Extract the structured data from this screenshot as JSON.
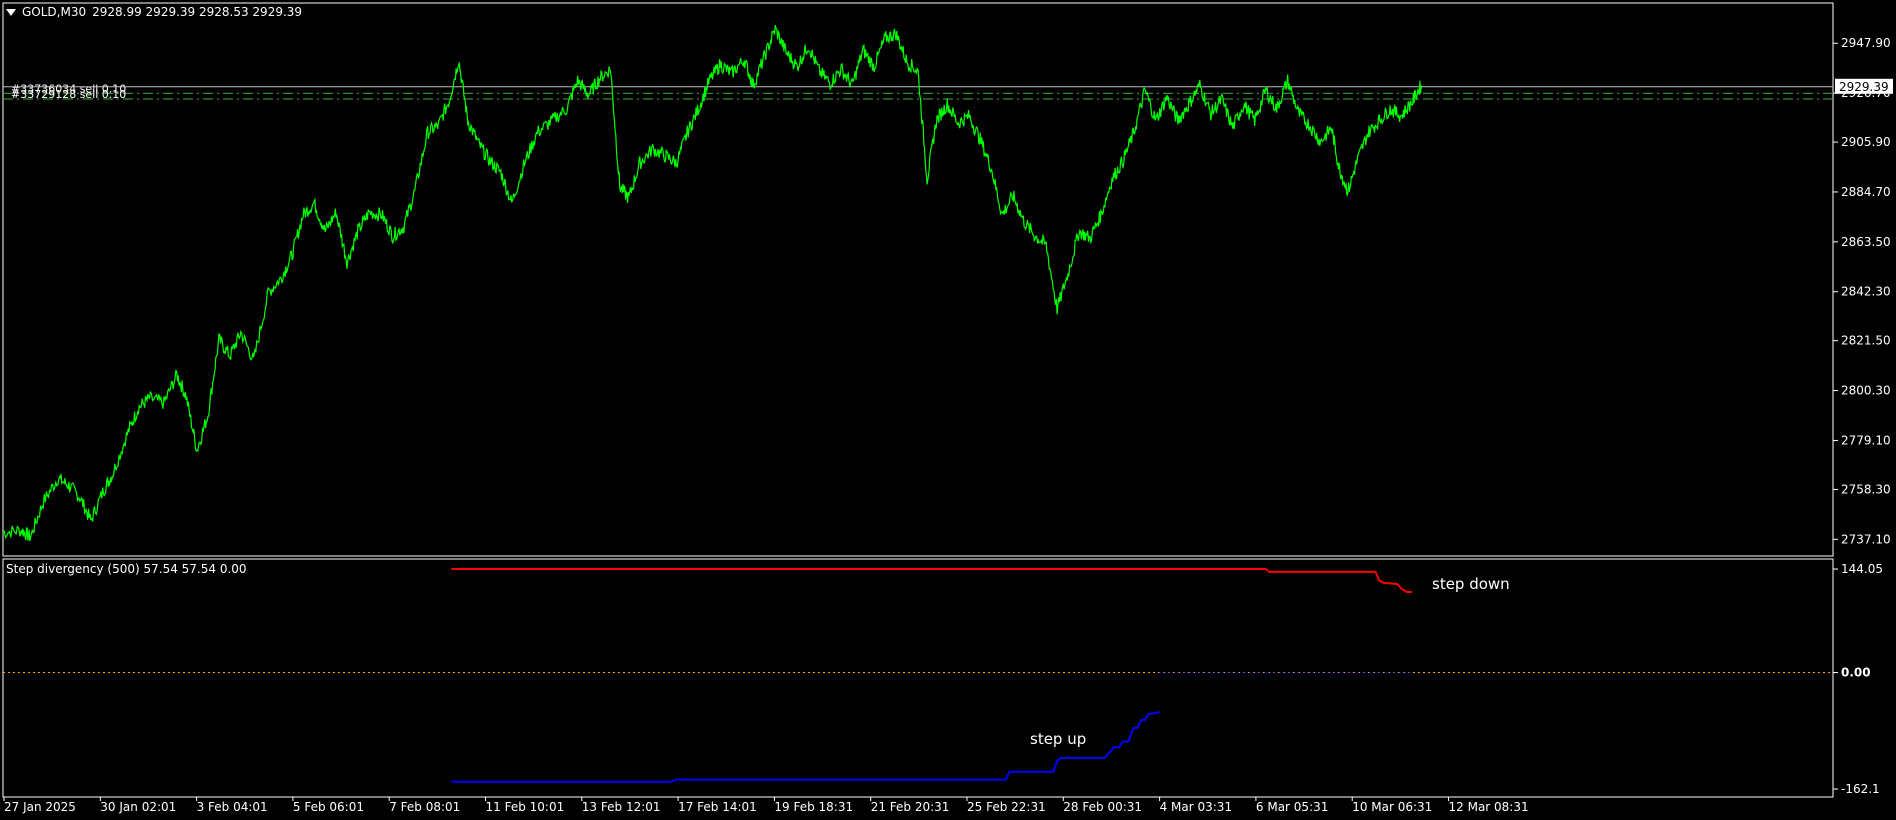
{
  "header": {
    "symbol": "GOLD,M30",
    "ohlc": "2928.99 2929.39 2928.53 2929.39"
  },
  "orders": [
    {
      "label": "#33736034 sell 0.10",
      "price": 2926.6
    },
    {
      "label": "#33729128 sell 0.10",
      "price": 2924.2
    }
  ],
  "current_price": {
    "label": "2929.39",
    "value": 2929.39
  },
  "indicator": {
    "title": "Step divergency (500) 57.54 57.54 0.00",
    "zero_label": "0.00",
    "annotations": {
      "down": "step down",
      "up": "step up"
    }
  },
  "colors": {
    "price_line": "#00ff00",
    "step_down": "#ff0000",
    "step_up": "#0000ff",
    "zero_line": "#ffa500",
    "grid_frame": "#ffffff",
    "order_line": "#2e8b2e"
  },
  "chart_data": [
    {
      "type": "line",
      "title": "GOLD,M30",
      "yticks": [
        "2947.90",
        "2926.70",
        "2905.90",
        "2884.70",
        "2863.50",
        "2842.30",
        "2821.50",
        "2800.30",
        "2779.10",
        "2758.30",
        "2737.10"
      ],
      "xticks": [
        "27 Jan 2025",
        "30 Jan 02:01",
        "3 Feb 04:01",
        "5 Feb 06:01",
        "7 Feb 08:01",
        "11 Feb 10:01",
        "13 Feb 12:01",
        "17 Feb 14:01",
        "19 Feb 18:31",
        "21 Feb 20:31",
        "25 Feb 22:31",
        "28 Feb 00:31",
        "4 Mar 03:31",
        "6 Mar 05:31",
        "10 Mar 06:31",
        "12 Mar 08:31"
      ],
      "ylim": [
        2730.0,
        2965.0
      ],
      "series": [
        {
          "color": "#00ff00",
          "points": [
            [
              0.0,
              2740
            ],
            [
              0.01,
              2741
            ],
            [
              0.015,
              2738
            ],
            [
              0.022,
              2753
            ],
            [
              0.03,
              2763
            ],
            [
              0.036,
              2760
            ],
            [
              0.042,
              2755
            ],
            [
              0.048,
              2745
            ],
            [
              0.055,
              2758
            ],
            [
              0.06,
              2765
            ],
            [
              0.068,
              2782
            ],
            [
              0.074,
              2793
            ],
            [
              0.08,
              2797
            ],
            [
              0.088,
              2795
            ],
            [
              0.095,
              2807
            ],
            [
              0.1,
              2798
            ],
            [
              0.106,
              2775
            ],
            [
              0.112,
              2790
            ],
            [
              0.118,
              2822
            ],
            [
              0.124,
              2815
            ],
            [
              0.13,
              2825
            ],
            [
              0.137,
              2813
            ],
            [
              0.145,
              2842
            ],
            [
              0.152,
              2848
            ],
            [
              0.158,
              2858
            ],
            [
              0.164,
              2875
            ],
            [
              0.17,
              2880
            ],
            [
              0.176,
              2868
            ],
            [
              0.182,
              2876
            ],
            [
              0.188,
              2855
            ],
            [
              0.194,
              2868
            ],
            [
              0.2,
              2876
            ],
            [
              0.207,
              2875
            ],
            [
              0.213,
              2866
            ],
            [
              0.219,
              2870
            ],
            [
              0.225,
              2885
            ],
            [
              0.232,
              2910
            ],
            [
              0.238,
              2913
            ],
            [
              0.244,
              2924
            ],
            [
              0.249,
              2941
            ],
            [
              0.254,
              2915
            ],
            [
              0.26,
              2905
            ],
            [
              0.266,
              2898
            ],
            [
              0.272,
              2893
            ],
            [
              0.278,
              2880
            ],
            [
              0.285,
              2897
            ],
            [
              0.292,
              2910
            ],
            [
              0.3,
              2915
            ],
            [
              0.308,
              2920
            ],
            [
              0.314,
              2932
            ],
            [
              0.32,
              2926
            ],
            [
              0.326,
              2933
            ],
            [
              0.332,
              2937
            ],
            [
              0.337,
              2887
            ],
            [
              0.342,
              2882
            ],
            [
              0.348,
              2897
            ],
            [
              0.355,
              2903
            ],
            [
              0.362,
              2900
            ],
            [
              0.368,
              2897
            ],
            [
              0.374,
              2910
            ],
            [
              0.38,
              2920
            ],
            [
              0.386,
              2932
            ],
            [
              0.392,
              2939
            ],
            [
              0.398,
              2935
            ],
            [
              0.405,
              2941
            ],
            [
              0.41,
              2930
            ],
            [
              0.416,
              2942
            ],
            [
              0.422,
              2954
            ],
            [
              0.428,
              2944
            ],
            [
              0.434,
              2938
            ],
            [
              0.44,
              2947
            ],
            [
              0.446,
              2936
            ],
            [
              0.452,
              2931
            ],
            [
              0.458,
              2937
            ],
            [
              0.464,
              2930
            ],
            [
              0.47,
              2945
            ],
            [
              0.476,
              2938
            ],
            [
              0.482,
              2950
            ],
            [
              0.488,
              2952
            ],
            [
              0.494,
              2940
            ],
            [
              0.5,
              2936
            ],
            [
              0.505,
              2890
            ],
            [
              0.51,
              2915
            ],
            [
              0.516,
              2922
            ],
            [
              0.522,
              2914
            ],
            [
              0.528,
              2917
            ],
            [
              0.534,
              2907
            ],
            [
              0.54,
              2895
            ],
            [
              0.546,
              2875
            ],
            [
              0.552,
              2883
            ],
            [
              0.558,
              2872
            ],
            [
              0.564,
              2866
            ],
            [
              0.57,
              2862
            ],
            [
              0.576,
              2835
            ],
            [
              0.582,
              2850
            ],
            [
              0.588,
              2868
            ],
            [
              0.594,
              2865
            ],
            [
              0.6,
              2875
            ],
            [
              0.606,
              2890
            ],
            [
              0.612,
              2898
            ],
            [
              0.618,
              2910
            ],
            [
              0.624,
              2928
            ],
            [
              0.63,
              2915
            ],
            [
              0.636,
              2925
            ],
            [
              0.642,
              2915
            ],
            [
              0.648,
              2922
            ],
            [
              0.654,
              2930
            ],
            [
              0.66,
              2918
            ],
            [
              0.666,
              2924
            ],
            [
              0.672,
              2912
            ],
            [
              0.678,
              2922
            ],
            [
              0.684,
              2915
            ],
            [
              0.69,
              2928
            ],
            [
              0.696,
              2920
            ],
            [
              0.702,
              2932
            ],
            [
              0.708,
              2918
            ],
            [
              0.714,
              2913
            ],
            [
              0.72,
              2906
            ],
            [
              0.726,
              2912
            ],
            [
              0.73,
              2895
            ],
            [
              0.735,
              2885
            ],
            [
              0.74,
              2898
            ],
            [
              0.746,
              2910
            ],
            [
              0.752,
              2915
            ],
            [
              0.758,
              2920
            ],
            [
              0.764,
              2917
            ],
            [
              0.77,
              2923
            ],
            [
              0.775,
              2930
            ]
          ]
        }
      ]
    },
    {
      "type": "line",
      "title": "Step divergency (500) 57.54 57.54 0.00",
      "yticks": [
        "144.05",
        "0.00",
        "-162.1"
      ],
      "ylim": [
        -162.1,
        144.05
      ],
      "series": [
        {
          "color": "#ff0000",
          "points": [
            [
              0.245,
              144.05
            ],
            [
              0.69,
              144.05
            ],
            [
              0.692,
              140
            ],
            [
              0.75,
              140
            ],
            [
              0.752,
              128
            ],
            [
              0.754,
              125
            ],
            [
              0.762,
              123
            ],
            [
              0.764,
              117
            ],
            [
              0.767,
              112
            ],
            [
              0.77,
              112
            ]
          ]
        },
        {
          "color": "#0000ff",
          "points": [
            [
              0.245,
              -152
            ],
            [
              0.365,
              -152
            ],
            [
              0.368,
              -149
            ],
            [
              0.548,
              -149
            ],
            [
              0.55,
              -138
            ],
            [
              0.574,
              -138
            ],
            [
              0.576,
              -123
            ],
            [
              0.578,
              -119
            ],
            [
              0.602,
              -119
            ],
            [
              0.605,
              -110
            ],
            [
              0.607,
              -104
            ],
            [
              0.61,
              -104
            ],
            [
              0.612,
              -96
            ],
            [
              0.615,
              -96
            ],
            [
              0.617,
              -82
            ],
            [
              0.618,
              -77
            ],
            [
              0.62,
              -77
            ],
            [
              0.622,
              -66
            ],
            [
              0.624,
              -66
            ],
            [
              0.626,
              -58
            ],
            [
              0.628,
              -57
            ],
            [
              0.63,
              -56
            ],
            [
              0.632,
              -55
            ]
          ]
        }
      ]
    }
  ]
}
